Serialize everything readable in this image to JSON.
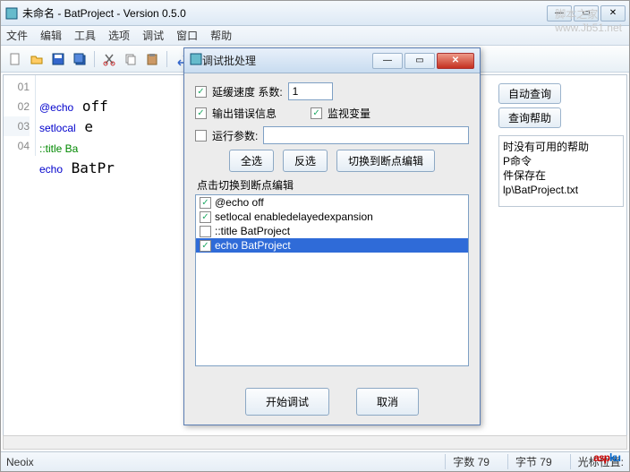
{
  "window": {
    "title": "未命名 - BatProject - Version 0.5.0"
  },
  "watermark": {
    "site_text": "脚本之家",
    "site_url_text": "www.Jb51.net"
  },
  "menus": {
    "file": "文件",
    "edit": "编辑",
    "tools": "工具",
    "options": "选项",
    "debug": "调试",
    "window": "窗口",
    "help": "帮助"
  },
  "editor": {
    "lines": [
      {
        "num": "01",
        "text": "@echo off"
      },
      {
        "num": "02",
        "text": "setlocal e"
      },
      {
        "num": "03",
        "text": "::title Ba"
      },
      {
        "num": "04",
        "text": "echo BatPr"
      }
    ]
  },
  "right_panel": {
    "auto_query": "自动查询",
    "help_button": "查询帮助",
    "msg1": "时没有可用的帮助",
    "msg2": "P命令",
    "msg3": "件保存在",
    "msg4": "lp\\BatProject.txt"
  },
  "status": {
    "user": "Neoix",
    "chars": "字数  79",
    "bytes": "字节  79",
    "cursor": "光标位置:"
  },
  "dialog": {
    "title": "调试批处理",
    "speed_label": "延缓速度   系数:",
    "speed_value": "1",
    "output_err": "输出错误信息",
    "watch_var": "监视变量",
    "run_args": "运行参数:",
    "select_all": "全选",
    "invert": "反选",
    "switch_bp": "切换到断点编辑",
    "list_label": "点击切换到断点编辑",
    "items": [
      {
        "checked": true,
        "text": "@echo off"
      },
      {
        "checked": true,
        "text": "setlocal enabledelayedexpansion"
      },
      {
        "checked": false,
        "text": "::title BatProject"
      },
      {
        "checked": true,
        "text": "echo BatProject",
        "selected": true
      }
    ],
    "start": "开始调试",
    "cancel": "取消"
  },
  "brand": {
    "part1": "asp",
    "part2": "ku"
  }
}
